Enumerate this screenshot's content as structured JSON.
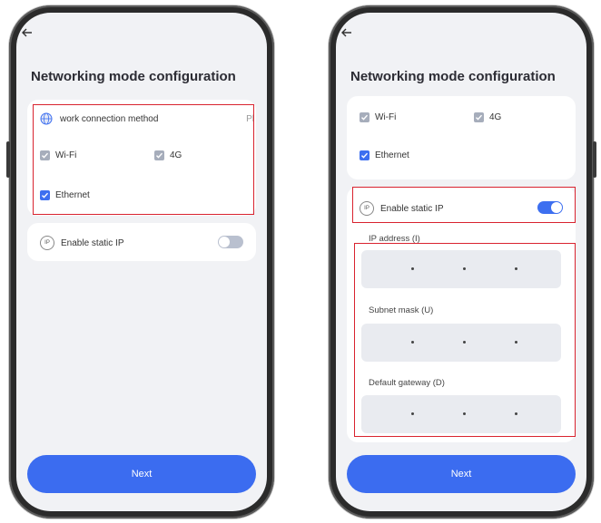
{
  "left": {
    "title": "Networking mode configuration",
    "network_method_label": "work connection method",
    "network_method_value": "Pl",
    "options": [
      {
        "label": "Wi-Fi",
        "checked": true,
        "state": "disabled"
      },
      {
        "label": "4G",
        "checked": true,
        "state": "disabled"
      },
      {
        "label": "Ethernet",
        "checked": true,
        "state": "active"
      }
    ],
    "static_ip_label": "Enable static IP",
    "static_ip_icon_text": "IP",
    "static_ip_enabled": false,
    "next_label": "Next"
  },
  "right": {
    "title": "Networking mode configuration",
    "options": [
      {
        "label": "Wi-Fi",
        "checked": true,
        "state": "disabled"
      },
      {
        "label": "4G",
        "checked": true,
        "state": "disabled"
      },
      {
        "label": "Ethernet",
        "checked": true,
        "state": "active"
      }
    ],
    "static_ip_label": "Enable static IP",
    "static_ip_icon_text": "IP",
    "static_ip_enabled": true,
    "ip_address_label": "IP address (I)",
    "subnet_mask_label": "Subnet mask (U)",
    "default_gateway_label": "Default gateway (D)",
    "next_label": "Next"
  },
  "colors": {
    "accent": "#3d6ff0",
    "highlight_border": "#d9232f",
    "disabled_checkbox": "#a6adbb"
  }
}
